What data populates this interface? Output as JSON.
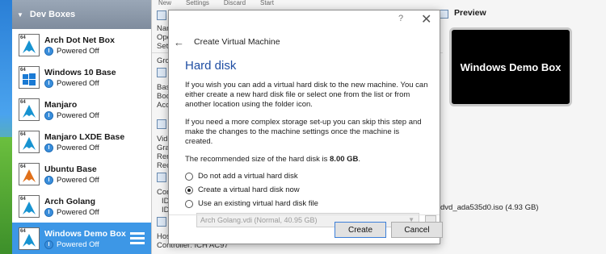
{
  "sidebar": {
    "group_label": "Dev Boxes",
    "machines": [
      {
        "name": "Arch Dot Net Box",
        "state": "Powered Off",
        "badge": "64"
      },
      {
        "name": "Windows 10 Base",
        "state": "Powered Off",
        "badge": "64"
      },
      {
        "name": "Manjaro",
        "state": "Powered Off",
        "badge": "64"
      },
      {
        "name": "Manjaro LXDE Base",
        "state": "Powered Off",
        "badge": "64"
      },
      {
        "name": "Ubuntu Base",
        "state": "Powered Off",
        "badge": "64"
      },
      {
        "name": "Arch Golang",
        "state": "Powered Off",
        "badge": "64"
      },
      {
        "name": "Windows Demo Box",
        "state": "Powered Off",
        "badge": "64"
      }
    ]
  },
  "toolbar": {
    "items": [
      "New",
      "Settings",
      "Discard",
      "Start"
    ]
  },
  "details": {
    "labels": [
      "Nam",
      "Ope",
      "Sett",
      "Grou",
      "Base",
      "Boot",
      "Acce",
      "Vide",
      "Grap",
      "Rem",
      "Reco",
      "Cont",
      "IDE",
      "IDE",
      "Host",
      "Controller: ICH AC97"
    ],
    "preview_title": "Preview",
    "preview_text": "Windows Demo Box",
    "iso_text": "dvd_ada535d0.iso (4.93 GB)"
  },
  "dialog": {
    "help_glyph": "?",
    "close_glyph": "✕",
    "back_glyph": "←",
    "nav_title": "Create Virtual Machine",
    "page_title": "Hard disk",
    "para1": "If you wish you can add a virtual hard disk to the new machine. You can either create a new hard disk file or select one from the list or from another location using the folder icon.",
    "para2": "If you need a more complex storage set-up you can skip this step and make the changes to the machine settings once the machine is created.",
    "recommended_prefix": "The recommended size of the hard disk is ",
    "recommended_size": "8.00 GB",
    "recommended_suffix": ".",
    "options": [
      {
        "label": "Do not add a virtual hard disk",
        "selected": false
      },
      {
        "label": "Create a virtual hard disk now",
        "selected": true
      },
      {
        "label": "Use an existing virtual hard disk file",
        "selected": false
      }
    ],
    "existing_file": "Arch Golang.vdi (Normal, 40.95 GB)",
    "create_label": "Create",
    "cancel_label": "Cancel"
  }
}
